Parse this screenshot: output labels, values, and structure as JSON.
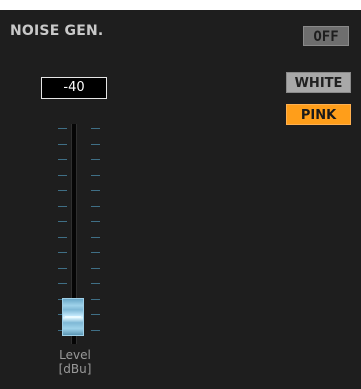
{
  "module": {
    "title": "NOISE GEN.",
    "power_button": "OFF"
  },
  "noise_type": {
    "options": [
      "WHITE",
      "PINK"
    ],
    "selected": "PINK"
  },
  "level": {
    "value": "-40",
    "label_line1": "Level",
    "label_line2": "[dBu]"
  },
  "colors": {
    "panel_bg": "#1e1e1e",
    "active_orange": "#ff9e1a",
    "inactive_gray": "#a8a8a8",
    "off_gray": "#6e6e6e",
    "scale_tick": "#3f6f86",
    "fader_cap": "#9fd3ea"
  }
}
